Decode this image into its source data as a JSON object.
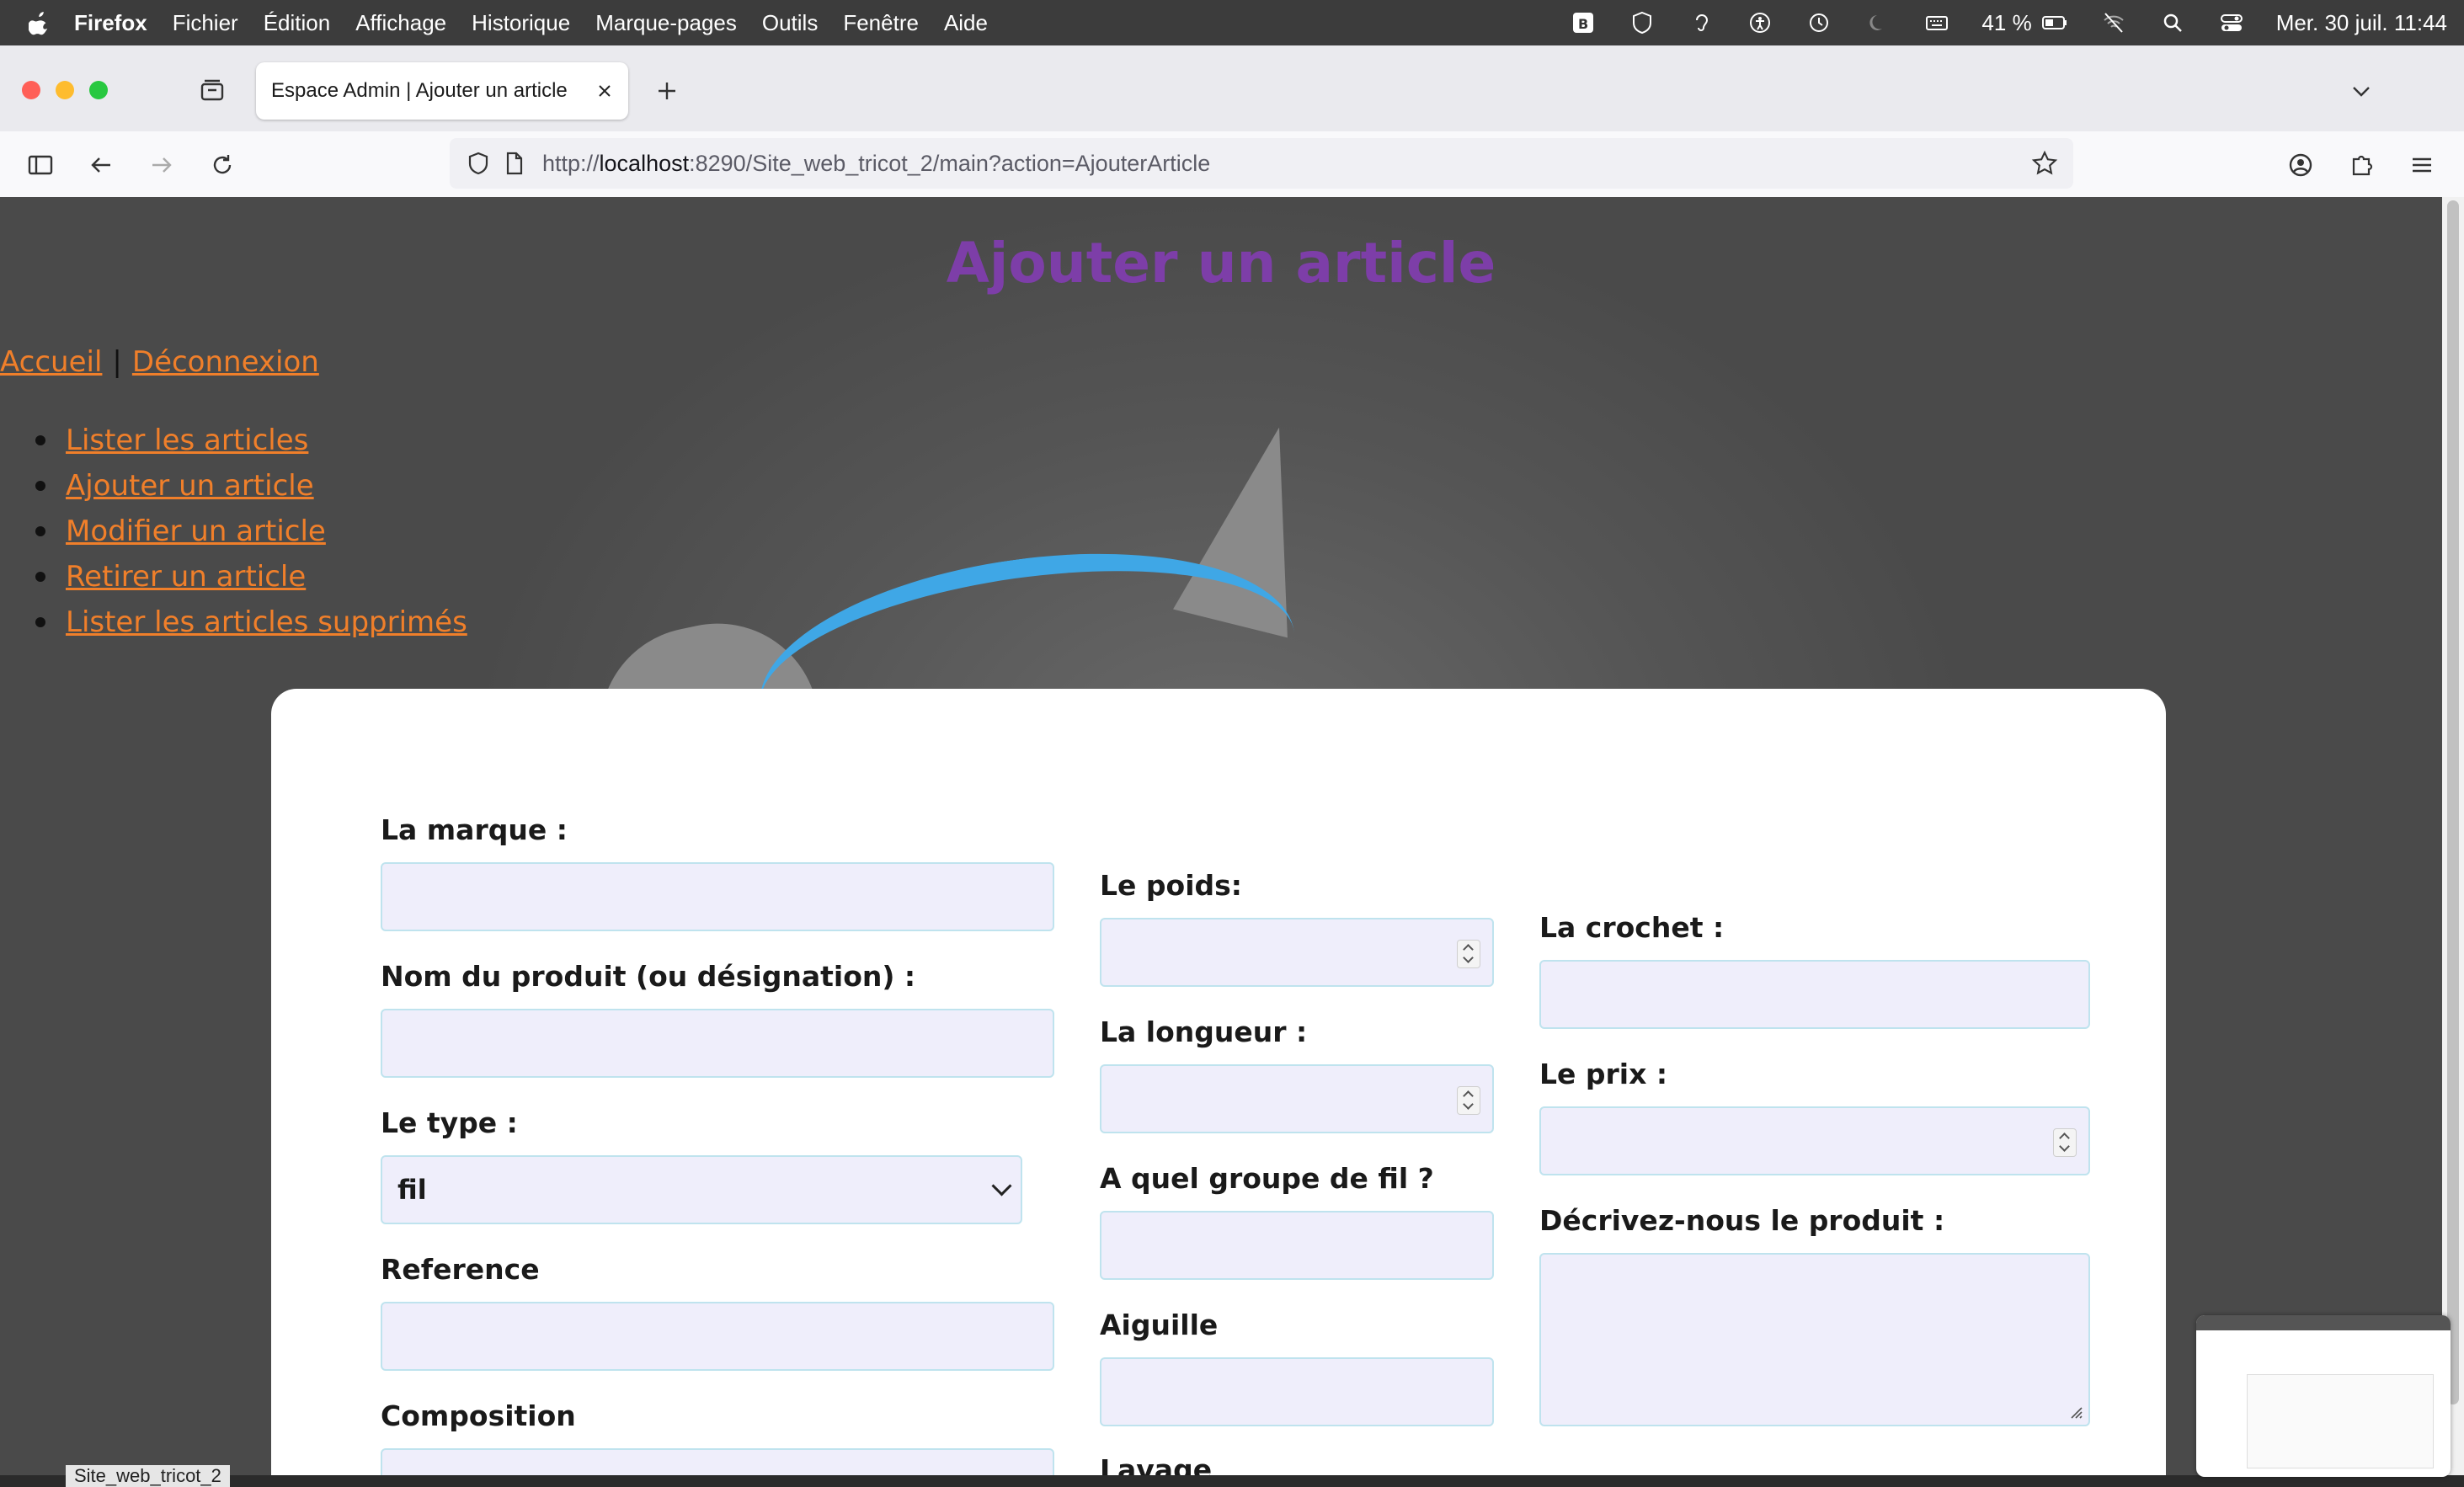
{
  "menubar": {
    "app": "Firefox",
    "items": [
      "Fichier",
      "Édition",
      "Affichage",
      "Historique",
      "Marque-pages",
      "Outils",
      "Fenêtre",
      "Aide"
    ],
    "battery": "41 %",
    "datetime": "Mer. 30 juil.  11:44"
  },
  "browser": {
    "tab_title": "Espace Admin | Ajouter un article",
    "url_prefix": "http://",
    "url_host": "localhost",
    "url_rest": ":8290/Site_web_tricot_2/main?action=AjouterArticle"
  },
  "page": {
    "title": "Ajouter un article",
    "top_links": [
      "Accueil",
      "Déconnexion"
    ],
    "separator": "|",
    "menu": [
      "Lister les articles",
      "Ajouter un article",
      "Modifier un article",
      "Retirer un article",
      "Lister les articles supprimés"
    ]
  },
  "form": {
    "marque": "La marque :",
    "nom": "Nom du produit (ou désignation) :",
    "type": "Le type :",
    "type_value": "fil",
    "reference": "Reference",
    "composition": "Composition",
    "poids": "Le poids:",
    "longueur": "La longueur :",
    "groupe": "A quel groupe de fil ?",
    "aiguille": "Aiguille",
    "lavage": "Lavage",
    "crochet": "La crochet :",
    "prix": "Le prix :",
    "description": "Décrivez-nous le produit :"
  },
  "dock": {
    "window_label": "Site_web_tricot_2"
  },
  "colors": {
    "title": "#7d3ea8",
    "link": "#f07f2a",
    "input_bg": "#efeefb",
    "input_border": "#bfe3ee"
  }
}
